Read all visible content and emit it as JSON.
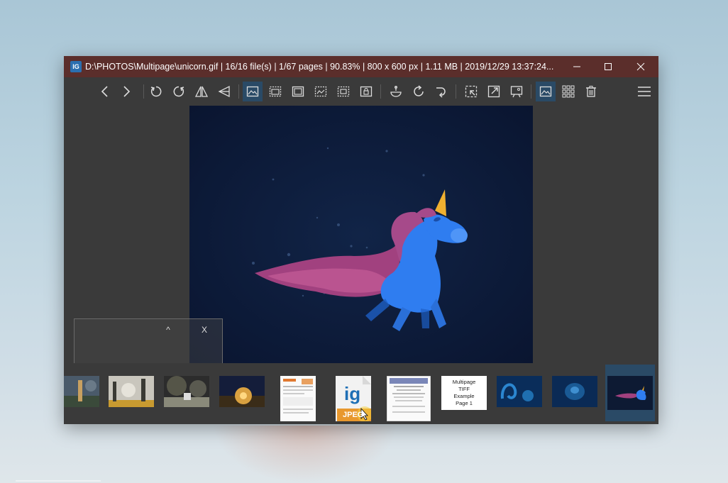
{
  "window": {
    "icon_text": "IG",
    "title": "D:\\PHOTOS\\Multipage\\unicorn.gif | 16/16 file(s) | 1/67 pages | 90.83% | 800 x 600 px | 1.11 MB | 2019/12/29 13:37:24..."
  },
  "toolbar": {
    "buttons": [
      "previous",
      "next",
      "rotate-left",
      "rotate-right",
      "flip-horizontal",
      "flip-vertical",
      "fit-best",
      "fit-width",
      "fit-height",
      "actual-size",
      "auto-zoom",
      "lock-zoom",
      "crop",
      "refresh",
      "auto-rotate",
      "copy-to",
      "resize",
      "slideshow",
      "viewer-mode",
      "grid-view",
      "delete",
      "menu"
    ],
    "active": [
      "fit-best",
      "viewer-mode"
    ]
  },
  "nav_panel": {
    "collapse_label": "^",
    "close_label": "X"
  },
  "thumbnails": [
    {
      "kind": "photo",
      "colors": [
        "#4a5a6a",
        "#c8a060"
      ]
    },
    {
      "kind": "photo",
      "colors": [
        "#c9c6bd",
        "#c89a30"
      ]
    },
    {
      "kind": "photo",
      "colors": [
        "#2c2c2c",
        "#8a8a7a"
      ]
    },
    {
      "kind": "photo",
      "colors": [
        "#141d3a",
        "#d9a140"
      ]
    },
    {
      "kind": "document"
    },
    {
      "kind": "jpeg-file",
      "label": "JPEG"
    },
    {
      "kind": "document"
    },
    {
      "kind": "tiff",
      "lines": [
        "Multipage",
        "TIFF",
        "Example",
        "Page 1"
      ]
    },
    {
      "kind": "photo",
      "colors": [
        "#0a2d5a",
        "#1f6fb0"
      ]
    },
    {
      "kind": "photo",
      "colors": [
        "#0a2a55",
        "#1a5a95"
      ]
    },
    {
      "kind": "unicorn",
      "selected": true
    }
  ],
  "colors": {
    "titlebar": "#5b2e2b",
    "active": "#2a4a66",
    "unicorn_body": "#2f7df0",
    "unicorn_mane": "#b24a8a",
    "horn": "#f0b030"
  }
}
